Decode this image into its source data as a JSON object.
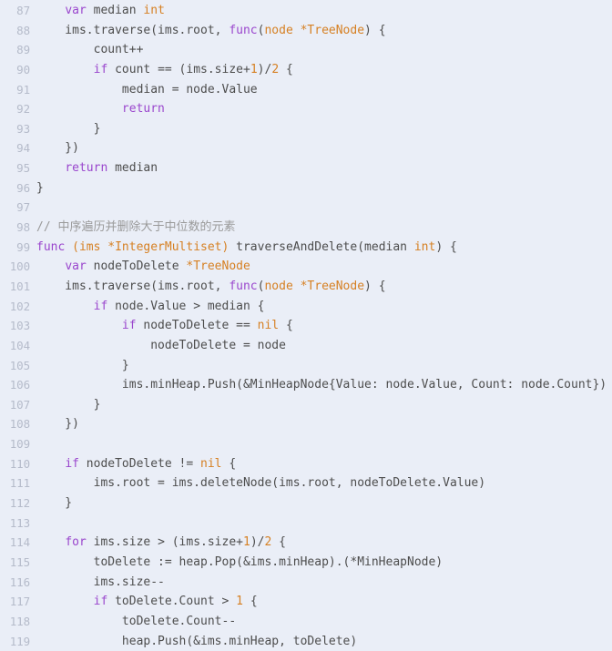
{
  "editor": {
    "language": "go",
    "first_line_number": 87,
    "last_line_number": 119,
    "theme": {
      "background": "#eaeef7",
      "line_number_color": "#b5bbca",
      "text_color": "#4d4d4d",
      "keyword_color": "#9a46cd",
      "type_color": "#d68023",
      "number_color": "#d68023",
      "comment_color": "#9a9a9a"
    }
  },
  "lines": [
    {
      "number": "87",
      "tokens": [
        {
          "t": "    ",
          "c": "pln"
        },
        {
          "t": "var",
          "c": "kw"
        },
        {
          "t": " median ",
          "c": "pln"
        },
        {
          "t": "int",
          "c": "typ"
        }
      ]
    },
    {
      "number": "88",
      "tokens": [
        {
          "t": "    ims.traverse(ims.root, ",
          "c": "pln"
        },
        {
          "t": "func",
          "c": "kw"
        },
        {
          "t": "(",
          "c": "pln"
        },
        {
          "t": "node *TreeNode",
          "c": "typ"
        },
        {
          "t": ") {",
          "c": "pln"
        }
      ]
    },
    {
      "number": "89",
      "tokens": [
        {
          "t": "        count++",
          "c": "pln"
        }
      ]
    },
    {
      "number": "90",
      "tokens": [
        {
          "t": "        ",
          "c": "pln"
        },
        {
          "t": "if",
          "c": "kw"
        },
        {
          "t": " count == (ims.size+",
          "c": "pln"
        },
        {
          "t": "1",
          "c": "num"
        },
        {
          "t": ")/",
          "c": "pln"
        },
        {
          "t": "2",
          "c": "num"
        },
        {
          "t": " {",
          "c": "pln"
        }
      ]
    },
    {
      "number": "91",
      "tokens": [
        {
          "t": "            median = node.Value",
          "c": "pln"
        }
      ]
    },
    {
      "number": "92",
      "tokens": [
        {
          "t": "            ",
          "c": "pln"
        },
        {
          "t": "return",
          "c": "kw"
        }
      ]
    },
    {
      "number": "93",
      "tokens": [
        {
          "t": "        }",
          "c": "pln"
        }
      ]
    },
    {
      "number": "94",
      "tokens": [
        {
          "t": "    })",
          "c": "pln"
        }
      ]
    },
    {
      "number": "95",
      "tokens": [
        {
          "t": "    ",
          "c": "pln"
        },
        {
          "t": "return",
          "c": "kw"
        },
        {
          "t": " median",
          "c": "pln"
        }
      ]
    },
    {
      "number": "96",
      "tokens": [
        {
          "t": "}",
          "c": "pln"
        }
      ]
    },
    {
      "number": "97",
      "tokens": [
        {
          "t": "",
          "c": "pln"
        }
      ]
    },
    {
      "number": "98",
      "tokens": [
        {
          "t": "// 中序遍历并删除大于中位数的元素",
          "c": "cmt"
        }
      ]
    },
    {
      "number": "99",
      "tokens": [
        {
          "t": "func",
          "c": "kw"
        },
        {
          "t": " ",
          "c": "pln"
        },
        {
          "t": "(ims *IntegerMultiset)",
          "c": "typ"
        },
        {
          "t": " traverseAndDelete(median ",
          "c": "pln"
        },
        {
          "t": "int",
          "c": "typ"
        },
        {
          "t": ") {",
          "c": "pln"
        }
      ]
    },
    {
      "number": "100",
      "tokens": [
        {
          "t": "    ",
          "c": "pln"
        },
        {
          "t": "var",
          "c": "kw"
        },
        {
          "t": " nodeToDelete ",
          "c": "pln"
        },
        {
          "t": "*TreeNode",
          "c": "typ"
        }
      ]
    },
    {
      "number": "101",
      "tokens": [
        {
          "t": "    ims.traverse(ims.root, ",
          "c": "pln"
        },
        {
          "t": "func",
          "c": "kw"
        },
        {
          "t": "(",
          "c": "pln"
        },
        {
          "t": "node *TreeNode",
          "c": "typ"
        },
        {
          "t": ") {",
          "c": "pln"
        }
      ]
    },
    {
      "number": "102",
      "tokens": [
        {
          "t": "        ",
          "c": "pln"
        },
        {
          "t": "if",
          "c": "kw"
        },
        {
          "t": " node.Value > median {",
          "c": "pln"
        }
      ]
    },
    {
      "number": "103",
      "tokens": [
        {
          "t": "            ",
          "c": "pln"
        },
        {
          "t": "if",
          "c": "kw"
        },
        {
          "t": " nodeToDelete == ",
          "c": "pln"
        },
        {
          "t": "nil",
          "c": "typ"
        },
        {
          "t": " {",
          "c": "pln"
        }
      ]
    },
    {
      "number": "104",
      "tokens": [
        {
          "t": "                nodeToDelete = node",
          "c": "pln"
        }
      ]
    },
    {
      "number": "105",
      "tokens": [
        {
          "t": "            }",
          "c": "pln"
        }
      ]
    },
    {
      "number": "106",
      "tokens": [
        {
          "t": "            ims.minHeap.Push(&MinHeapNode{Value: node.Value, Count: node.Count})",
          "c": "pln"
        }
      ]
    },
    {
      "number": "107",
      "tokens": [
        {
          "t": "        }",
          "c": "pln"
        }
      ]
    },
    {
      "number": "108",
      "tokens": [
        {
          "t": "    })",
          "c": "pln"
        }
      ]
    },
    {
      "number": "109",
      "tokens": [
        {
          "t": "",
          "c": "pln"
        }
      ]
    },
    {
      "number": "110",
      "tokens": [
        {
          "t": "    ",
          "c": "pln"
        },
        {
          "t": "if",
          "c": "kw"
        },
        {
          "t": " nodeToDelete != ",
          "c": "pln"
        },
        {
          "t": "nil",
          "c": "typ"
        },
        {
          "t": " {",
          "c": "pln"
        }
      ]
    },
    {
      "number": "111",
      "tokens": [
        {
          "t": "        ims.root = ims.deleteNode(ims.root, nodeToDelete.Value)",
          "c": "pln"
        }
      ]
    },
    {
      "number": "112",
      "tokens": [
        {
          "t": "    }",
          "c": "pln"
        }
      ]
    },
    {
      "number": "113",
      "tokens": [
        {
          "t": "",
          "c": "pln"
        }
      ]
    },
    {
      "number": "114",
      "tokens": [
        {
          "t": "    ",
          "c": "pln"
        },
        {
          "t": "for",
          "c": "kw"
        },
        {
          "t": " ims.size > (ims.size+",
          "c": "pln"
        },
        {
          "t": "1",
          "c": "num"
        },
        {
          "t": ")/",
          "c": "pln"
        },
        {
          "t": "2",
          "c": "num"
        },
        {
          "t": " {",
          "c": "pln"
        }
      ]
    },
    {
      "number": "115",
      "tokens": [
        {
          "t": "        toDelete := heap.Pop(&ims.minHeap).(*MinHeapNode)",
          "c": "pln"
        }
      ]
    },
    {
      "number": "116",
      "tokens": [
        {
          "t": "        ims.size--",
          "c": "pln"
        }
      ]
    },
    {
      "number": "117",
      "tokens": [
        {
          "t": "        ",
          "c": "pln"
        },
        {
          "t": "if",
          "c": "kw"
        },
        {
          "t": " toDelete.Count > ",
          "c": "pln"
        },
        {
          "t": "1",
          "c": "num"
        },
        {
          "t": " {",
          "c": "pln"
        }
      ]
    },
    {
      "number": "118",
      "tokens": [
        {
          "t": "            toDelete.Count--",
          "c": "pln"
        }
      ]
    },
    {
      "number": "119",
      "tokens": [
        {
          "t": "            heap.Push(&ims.minHeap, toDelete)",
          "c": "pln"
        }
      ]
    }
  ]
}
